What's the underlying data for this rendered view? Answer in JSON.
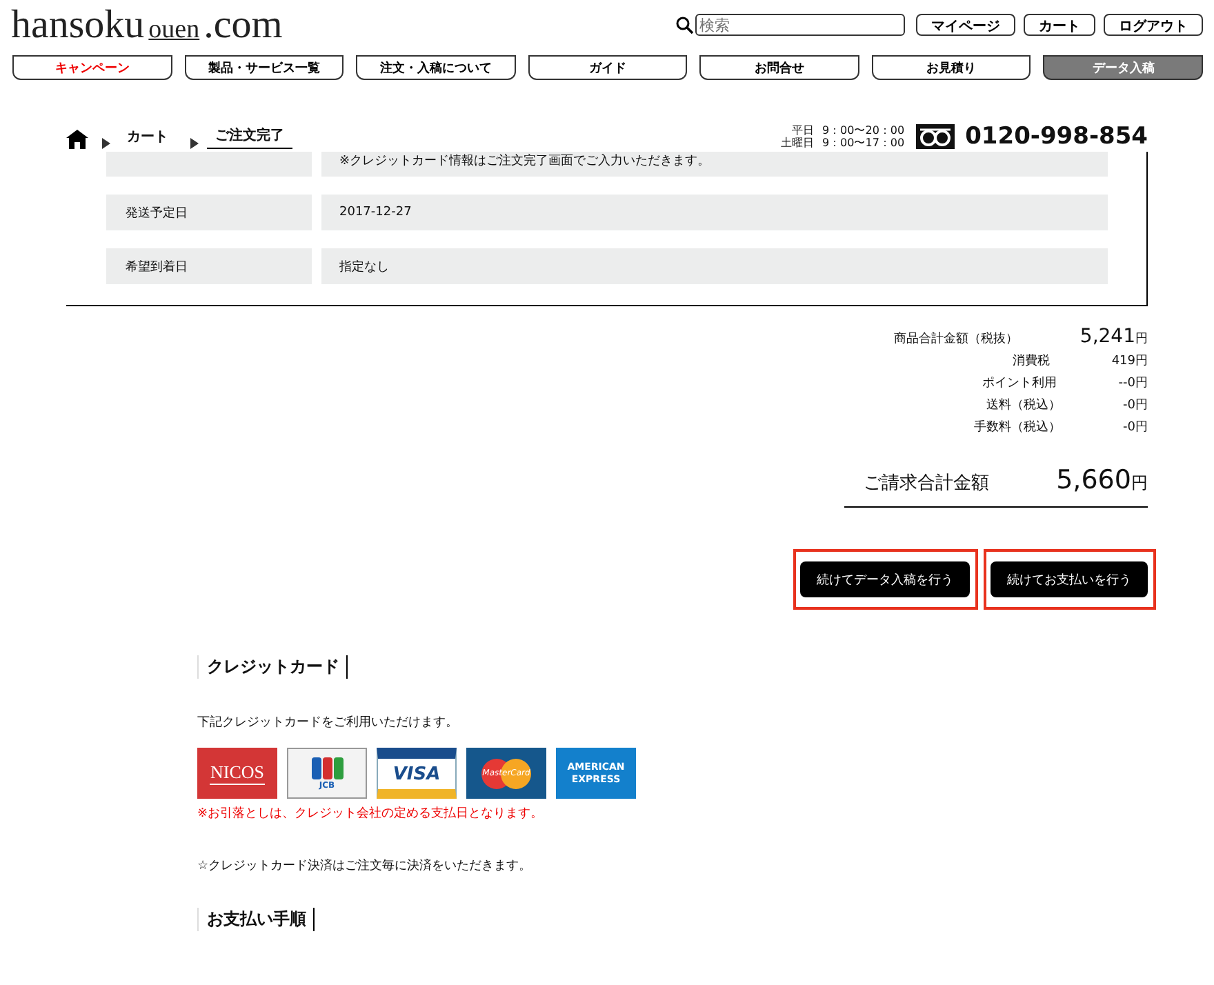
{
  "logo": {
    "main": "hansoku",
    "sub": "ouen",
    ".com": ".com"
  },
  "search": {
    "placeholder": "検索"
  },
  "header_links": [
    "マイページ",
    "カート",
    "ログアウト"
  ],
  "nav": [
    {
      "label": "キャンペーン",
      "selected": false,
      "kind": "promo"
    },
    {
      "label": "製品・サービス一覧",
      "selected": false,
      "kind": "normal"
    },
    {
      "label": "注文・入稿について",
      "selected": false,
      "kind": "normal"
    },
    {
      "label": "ガイド",
      "selected": false,
      "kind": "normal"
    },
    {
      "label": "お問合せ",
      "selected": false,
      "kind": "normal"
    },
    {
      "label": "お見積り",
      "selected": false,
      "kind": "normal"
    },
    {
      "label": "データ入稿",
      "selected": true,
      "kind": "normal"
    }
  ],
  "breadcrumb": [
    {
      "label": "カート",
      "selected": false
    },
    {
      "label": "ご注文完了",
      "selected": true
    }
  ],
  "hours": [
    {
      "day": "平日",
      "time": "9：00〜20：00"
    },
    {
      "day": "土曜日",
      "time": "9：00〜17：00"
    }
  ],
  "phone": "0120-998-854",
  "order_rows": [
    {
      "label": "",
      "value": "※クレジットカード情報はご注文完了画面でご入力いただきます。"
    },
    {
      "label": "発送予定日",
      "value": "2017-12-27"
    },
    {
      "label": "希望到着日",
      "value": "指定なし"
    }
  ],
  "totals": [
    {
      "label": "商品合計金額（税抜）",
      "value": "5,241",
      "unit": "円",
      "kind": "large"
    },
    {
      "label": "消費税",
      "value": "419円",
      "kind": "small"
    },
    {
      "label": "ポイント利用",
      "value": "--0円",
      "kind": "small"
    },
    {
      "label": "送料（税込）",
      "value": "-0円",
      "kind": "small"
    },
    {
      "label": "手数料（税込）",
      "value": "-0円",
      "kind": "small"
    }
  ],
  "grand_total": {
    "label": "ご請求合計金額",
    "value": "5,660",
    "unit": "円"
  },
  "buttons": [
    "続けてデータ入稿を行う",
    "続けてお支払いを行う"
  ],
  "credit": {
    "heading": "クレジットカード",
    "intro": "下記クレジットカードをご利用いただけます。",
    "cards": [
      {
        "kind": "nicos",
        "label": "NICOS"
      },
      {
        "kind": "jcb",
        "label": "JCB"
      },
      {
        "kind": "visa",
        "label": "VISA"
      },
      {
        "kind": "master",
        "label": "MasterCard"
      },
      {
        "kind": "amex",
        "label": "AMERICAN EXPRESS"
      }
    ],
    "notice": "※お引落としは、クレジット会社の定める支払日となります。",
    "note": "☆クレジットカード決済はご注文毎に決済をいただきます。"
  },
  "steps": {
    "heading": "お支払い手順"
  }
}
